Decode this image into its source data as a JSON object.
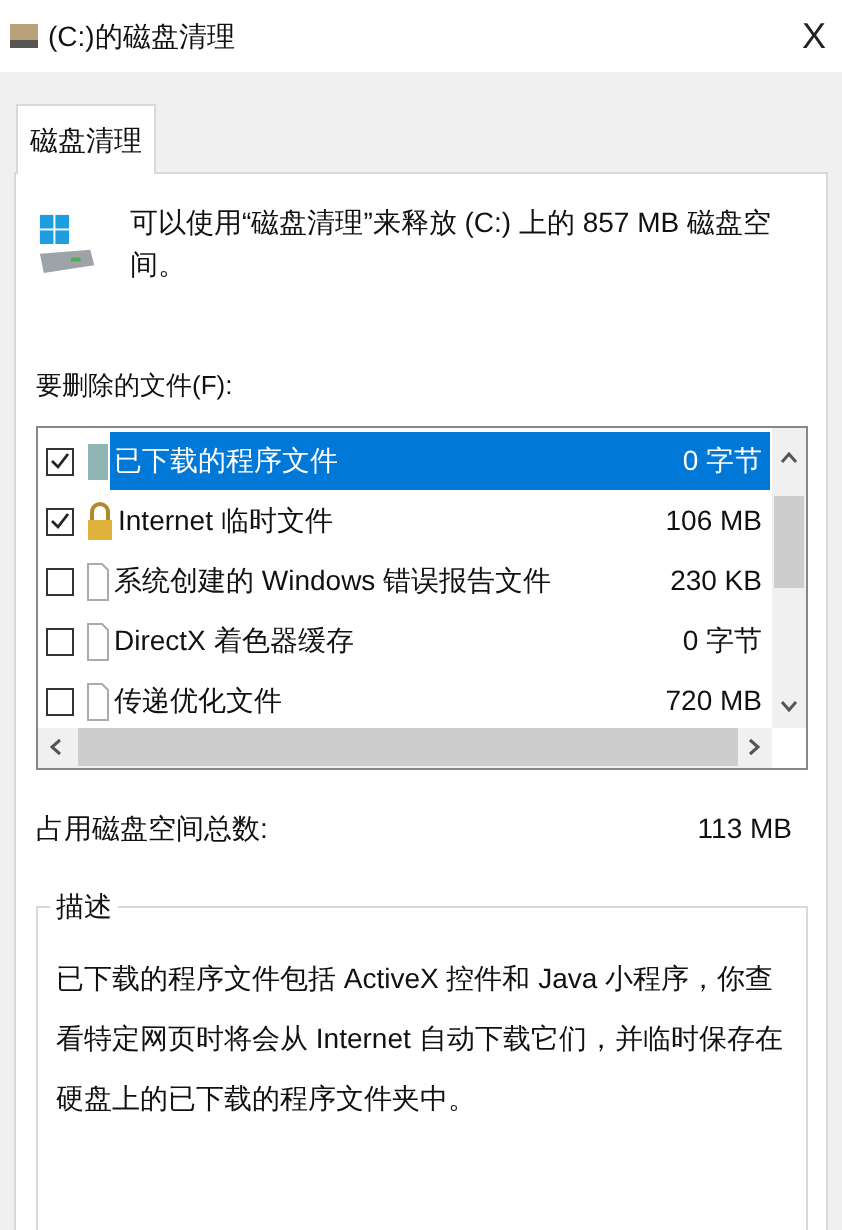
{
  "window": {
    "title": "(C:)的磁盘清理",
    "close": "X"
  },
  "tabs": [
    {
      "label": "磁盘清理",
      "selected": true
    }
  ],
  "header": {
    "message": "可以使用“磁盘清理”来释放 (C:) 上的 857 MB 磁盘空间。"
  },
  "files_label": "要删除的文件(F):",
  "files": [
    {
      "name": "已下载的程序文件",
      "size": "0 字节",
      "checked": true,
      "selected": true,
      "kind": "program"
    },
    {
      "name": "Internet 临时文件",
      "size": "106 MB",
      "checked": true,
      "selected": false,
      "kind": "lock"
    },
    {
      "name": "系统创建的 Windows 错误报告文件",
      "size": "230 KB",
      "checked": false,
      "selected": false,
      "kind": "file"
    },
    {
      "name": "DirectX 着色器缓存",
      "size": "0 字节",
      "checked": false,
      "selected": false,
      "kind": "file"
    },
    {
      "name": "传递优化文件",
      "size": "720 MB",
      "checked": false,
      "selected": false,
      "kind": "file"
    }
  ],
  "total": {
    "label": "占用磁盘空间总数:",
    "value": "113 MB"
  },
  "description": {
    "title": "描述",
    "text": "已下载的程序文件包括 ActiveX 控件和 Java 小程序，你查看特定网页时将会从 Internet 自动下载它们，并临时保存在硬盘上的已下载的程序文件夹中。"
  }
}
